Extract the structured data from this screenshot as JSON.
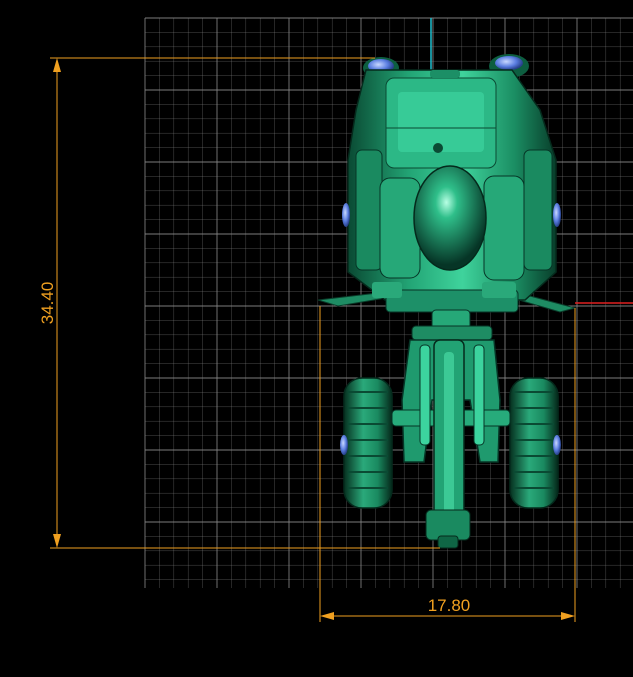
{
  "drawing": {
    "dim_height_label": "34.40",
    "dim_width_label": "17.80"
  },
  "colors": {
    "background": "#000000",
    "grid": "#8a8a8a",
    "dimension": "#f0a020",
    "body": "#1f9e72",
    "body_dark": "#0b4a34",
    "body_light": "#58e8b4",
    "light_lens": "#5a7de0",
    "x_axis": "#e02020",
    "y_axis": "#20c0d0"
  },
  "icons": {
    "vehicle": "tractor-backhoe-top-view"
  }
}
